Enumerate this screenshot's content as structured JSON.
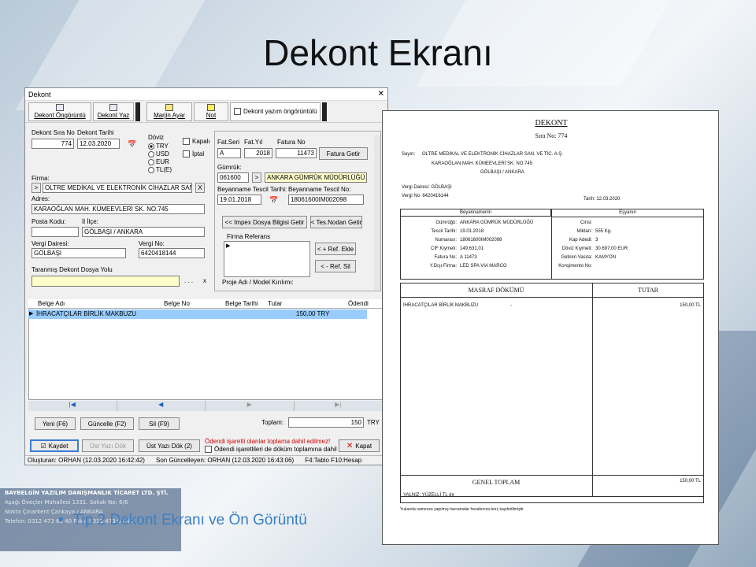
{
  "slide": {
    "title": "Dekont Ekranı",
    "bullet": "Tip 2 Dekont Ekranı ve Ön Görüntü",
    "company": [
      "BAYBELGİN YAZILIM DANIŞMANLIK TİCARET LTD. ŞTİ.",
      "Aşağı Öveçler Mahallesi 1331. Sokak No: 6/6",
      "Nokta Çınarkent Çankaya / ANKARA",
      "Telefon: 0312 473 65 40  Faks: 0312 473 65 36"
    ]
  },
  "window": {
    "title": "Dekont",
    "close": "✕",
    "toolbar": {
      "preview": "Dekont Öngörüntü",
      "print": "Dekont Yaz",
      "margin": "Marjin Ayar",
      "note": "Not",
      "print_preview_check": "Dekont yazım öngörüntülü"
    },
    "labels": {
      "sira_no": "Dekont Sıra No",
      "tarih": "Dekont Tarihi",
      "doviz": "Döviz",
      "kapali": "Kapalı",
      "iptal": "İptal",
      "firma": "Firma:",
      "adres": "Adres:",
      "posta": "Posta Kodu:",
      "ilce": "İl İlçe:",
      "vd": "Vergi Dairesi:",
      "vno": "Vergi No:",
      "yol": "Taranmış Dekont Dosya Yolu",
      "fat_seri": "Fat.Seri",
      "fat_yil": "Fat.Yıl",
      "fatura_no": "Fatura No",
      "gumruk": "Gümrük:",
      "bey_tarih": "Beyanname Tescil Tarihi:",
      "bey_no": "Beyanname Tescil No:",
      "firma_ref": "Firma Referans",
      "proje": "Proje Adı / Model Kırılımı:"
    },
    "currencies": [
      "TRY",
      "USD",
      "EUR",
      "TL(E)"
    ],
    "values": {
      "sira_no": "774",
      "tarih": "12.03.2020",
      "firma": "OLTRE MEDİKAL VE ELEKTRONİK CİHAZLAR SAN.",
      "adres": "KARAOĞLAN MAH. KÜMEEVLERİ SK. NO.745",
      "ilce": "GÖLBAŞI / ANKARA",
      "vd": "GÖLBAŞI",
      "vno": "6420418144",
      "fat_seri": "A",
      "fat_yil": "2018",
      "fatura_no": "11473",
      "gumruk_kod": "061600",
      "gumruk_ad": "ANKARA GÜMRÜK MÜDÜRLÜĞÜ",
      "bey_tarih": "19.01.2018",
      "bey_no": "18061600IM002098",
      "dots": ". . .",
      "x": "x"
    },
    "buttons": {
      "fatura_getir": "Fatura Getir",
      "impex": "<< Impex Dosya Bilgisi Getir",
      "tes": "< Tes.Nodan Getir",
      "ref_ekle": "< + Ref. Ekle",
      "ref_sil": "< - Ref. Sil",
      "yeni": "Yeni (F6)",
      "guncelle": "Güncelle (F2)",
      "sil": "Sil (F9)",
      "kaydet": "Kaydet",
      "ust_yazi": "Üst Yazı Dök",
      "ust_yazi2": "Üst Yazı Dök (2)",
      "kapat": "Kapat"
    },
    "grid": {
      "headers": [
        "Belge Adı",
        "Belge No",
        "Belge Tarihi",
        "Tutar",
        "Ödendi"
      ],
      "rows": [
        {
          "ad": "İHRACATÇILAR BİRLİK MAKBUZU",
          "tutar": "150,00 TRY"
        }
      ]
    },
    "nav": [
      "|◀",
      "◀",
      "▶",
      "▶|"
    ],
    "toplam": {
      "label": "Toplam:",
      "value": "150",
      "cur": "TRY"
    },
    "warning": "Ödendi işaretli olanlar toplama dahil edilmez!",
    "odendi_check": "Ödendi işaretlileri de döküm toplamına dahil et",
    "status": [
      "Oluşturan: ORHAN (12.03.2020 16:42:42)",
      "Son Güncelleyen: ORHAN (12.03.2020 16:43:06)",
      "F4:Tablo F10:Hesap"
    ]
  },
  "doc": {
    "title": "DEKONT",
    "sira": "Sıra No:  774",
    "sayin_label": "Sayın:",
    "sayin": "OLTRE MEDİKAL VE ELEKTRONİK CİHAZLAR SAN. VE TİC. A.Ş.",
    "adres1": "KARAOĞLAN MAH. KÜMEEVLERİ SK. NO.745",
    "adres2": "GÖLBAŞI / ANKARA",
    "vd": "Vergi Dairesi:  GÖLBAŞI",
    "vno": "Vergi No:      6420418144",
    "tarih": "Tarih:  12.03.2020",
    "bey_head": "Beyannamenin",
    "esya_head": "Eşyanın",
    "bey_rows": [
      [
        "Gümrüğü:",
        "ANKARA GÜMRÜK MÜDÜRLÜĞÜ"
      ],
      [
        "Tescil Tarihi:",
        "19.01.2018"
      ],
      [
        "Numarası:",
        "18061600IM002098"
      ],
      [
        "CIF Kıymeti:",
        "149.631,01"
      ],
      [
        "Fatura No:",
        "A 11473"
      ],
      [
        "Y.Dışı Firma:",
        "LED SPA VIA MARCO"
      ]
    ],
    "esya_rows": [
      [
        "Cinsi:",
        ""
      ],
      [
        "Miktarı:",
        "555 Kg."
      ],
      [
        "Kap Adedi:",
        "3"
      ],
      [
        "Döviz Kıymeti:",
        "30.697,00 EUR"
      ],
      [
        "Getiren Vasıta:",
        "KAMYON"
      ],
      [
        "Konşimento No:",
        ""
      ]
    ],
    "masraf_head": "MASRAF DÖKÜMÜ",
    "tutar_head": "TUTAR",
    "item": "İHRACATÇILAR BİRLİK MAKBUZU",
    "item_dash": "-",
    "item_tutar": "150,00 TL",
    "genel": "GENEL TOPLAM",
    "genel_tutar": "150,00 TL",
    "yalniz": "YALNIZ:  YÜZELLİ  TL  dır",
    "footer": "Yukarıda namınıza yapılmış harcamalar hesabınıza borç kaydedilmiştir."
  }
}
